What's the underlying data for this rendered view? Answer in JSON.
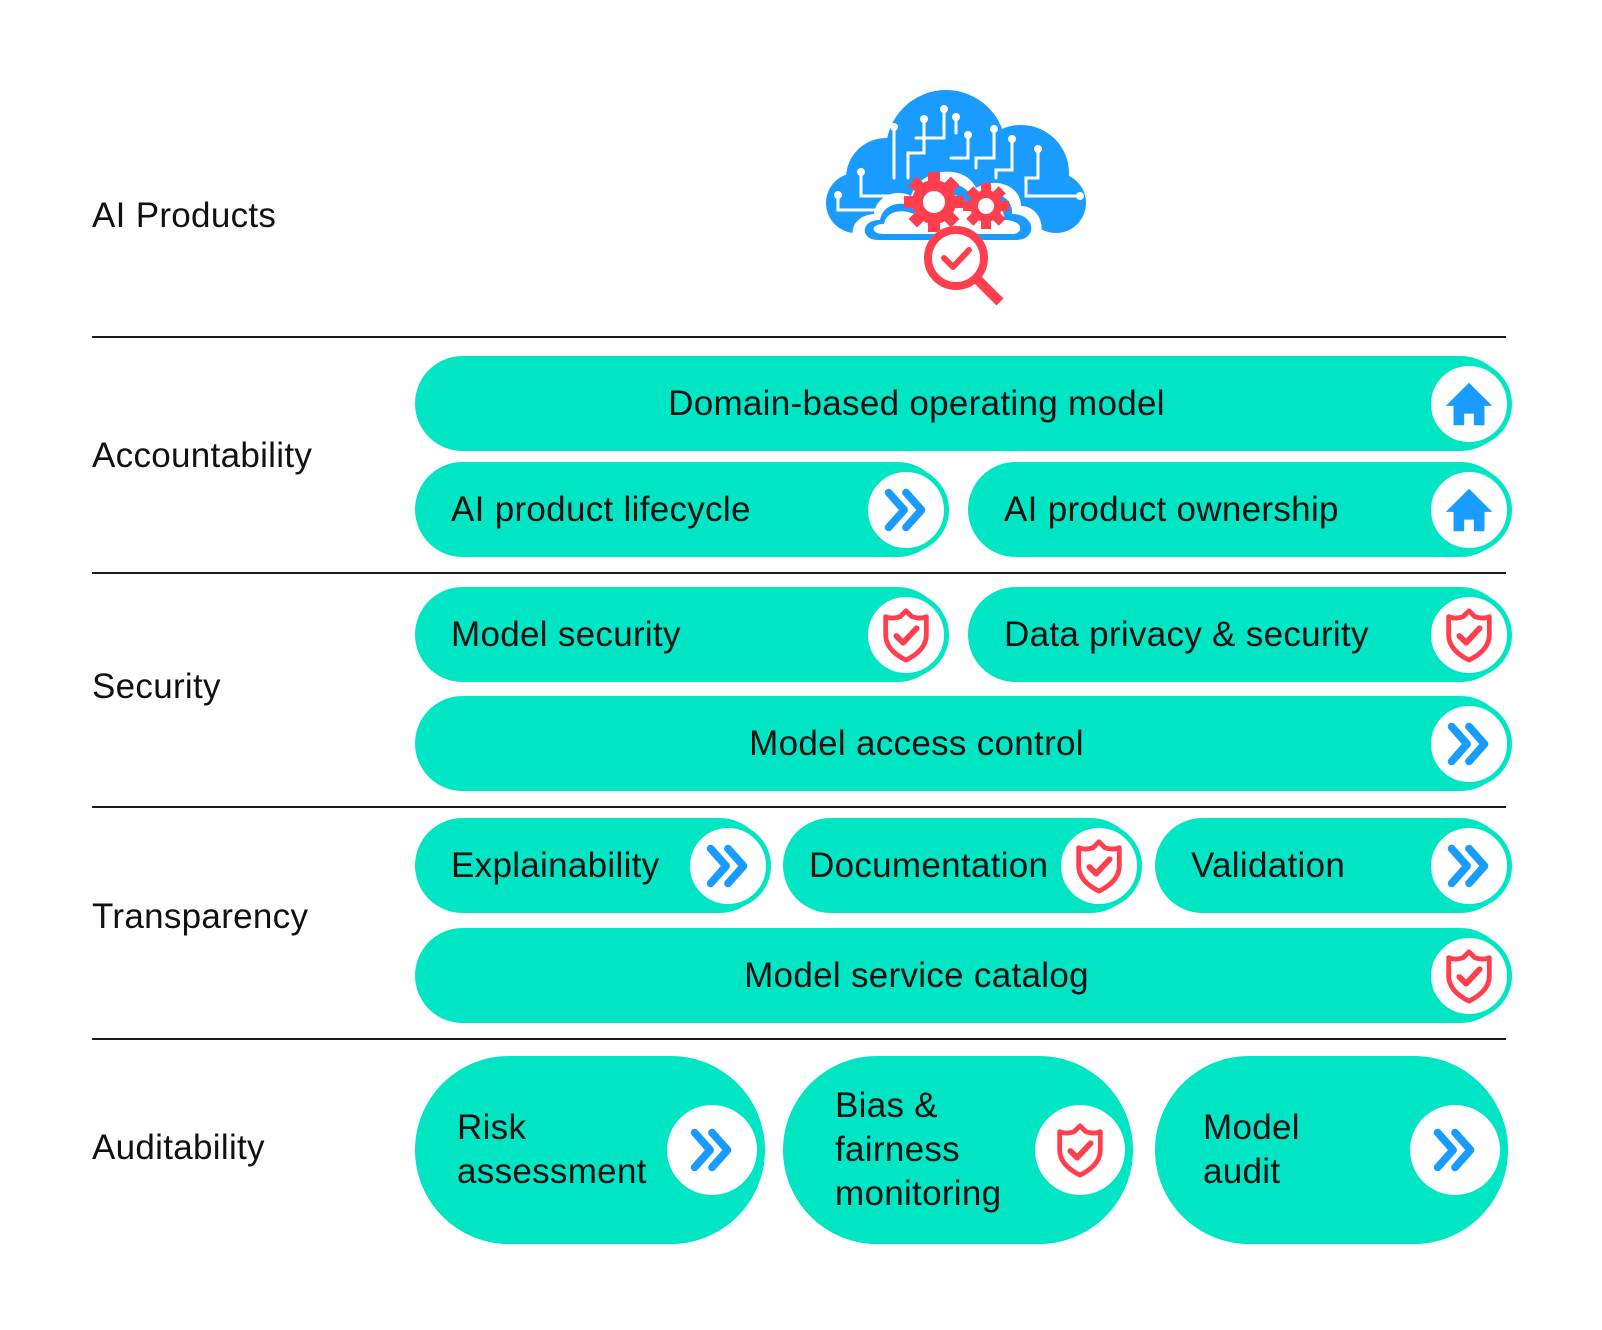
{
  "colors": {
    "pill": "#00E5C4",
    "icon_blue": "#1A9BFF",
    "icon_red": "#FF3F4E",
    "rule": "#1a1a1a"
  },
  "header": {
    "label": "AI Products",
    "hero_icon": "cloud-gears-check-icon"
  },
  "sections": [
    {
      "label": "Accountability",
      "items": [
        {
          "text": "Domain-based operating model",
          "icon": "home-icon"
        },
        {
          "text": "AI product lifecycle",
          "icon": "double-chevron-right-icon"
        },
        {
          "text": "AI product ownership",
          "icon": "home-icon"
        }
      ]
    },
    {
      "label": "Security",
      "items": [
        {
          "text": "Model security",
          "icon": "shield-check-icon"
        },
        {
          "text": "Data privacy & security",
          "icon": "shield-check-icon"
        },
        {
          "text": "Model access control",
          "icon": "double-chevron-right-icon"
        }
      ]
    },
    {
      "label": "Transparency",
      "items": [
        {
          "text": "Explainability",
          "icon": "double-chevron-right-icon"
        },
        {
          "text": "Documentation",
          "icon": "shield-check-icon"
        },
        {
          "text": "Validation",
          "icon": "double-chevron-right-icon"
        },
        {
          "text": "Model service catalog",
          "icon": "shield-check-icon"
        }
      ]
    },
    {
      "label": "Auditability",
      "items": [
        {
          "text": "Risk assessment",
          "lines": [
            "Risk",
            "assessment"
          ],
          "icon": "double-chevron-right-icon"
        },
        {
          "text": "Bias & fairness monitoring",
          "lines": [
            "Bias &",
            "fairness",
            "monitoring"
          ],
          "icon": "shield-check-icon"
        },
        {
          "text": "Model audit",
          "lines": [
            "Model",
            "audit"
          ],
          "icon": "double-chevron-right-icon"
        }
      ]
    }
  ]
}
